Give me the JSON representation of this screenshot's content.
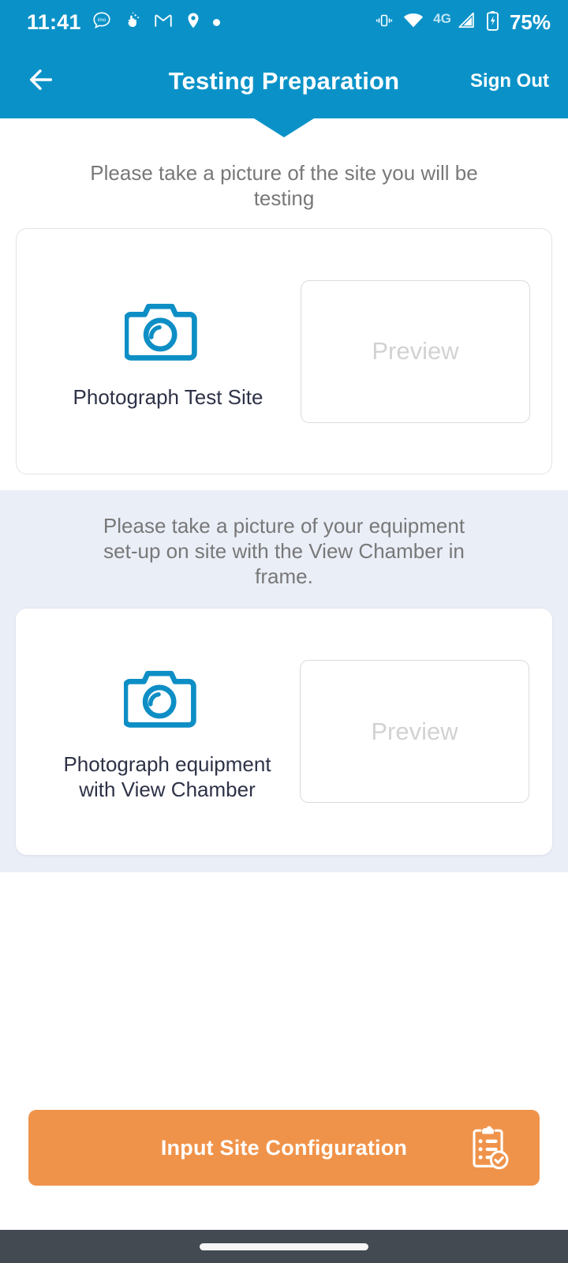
{
  "statusbar": {
    "time": "11:41",
    "icons_left": [
      "imo-chat-icon",
      "sparkle-hand-icon",
      "gmail-icon",
      "location-pin-icon",
      "dot-icon"
    ],
    "icons_right": [
      "vibrate-icon",
      "wifi-icon",
      "signal-icon",
      "battery-charging-icon"
    ],
    "network": "4G",
    "battery": "75%"
  },
  "appbar": {
    "back_icon": "arrow-left-icon",
    "title": "Testing Preparation",
    "signout_label": "Sign Out"
  },
  "sections": [
    {
      "prompt": "Please take a picture of the site you will be testing",
      "capture_icon": "camera-icon",
      "capture_label": "Photograph Test Site",
      "preview_label": "Preview"
    },
    {
      "prompt": "Please take a picture of your equipment set-up on site with the View Chamber in frame.",
      "capture_icon": "camera-icon",
      "capture_label": "Photograph equipment with View Chamber",
      "preview_label": "Preview"
    }
  ],
  "cta": {
    "label": "Input Site Configuration",
    "icon": "clipboard-check-icon"
  },
  "navbar": {
    "home_pill": "home-gesture-pill"
  },
  "colors": {
    "brand_blue": "#0a92c8",
    "accent_orange": "#f0934a",
    "tinted_section": "#eaeef7",
    "label_dark": "#2e3247",
    "prompt_gray": "#787878",
    "preview_gray": "#d2d2d2",
    "navbar_dark": "#434a52"
  }
}
